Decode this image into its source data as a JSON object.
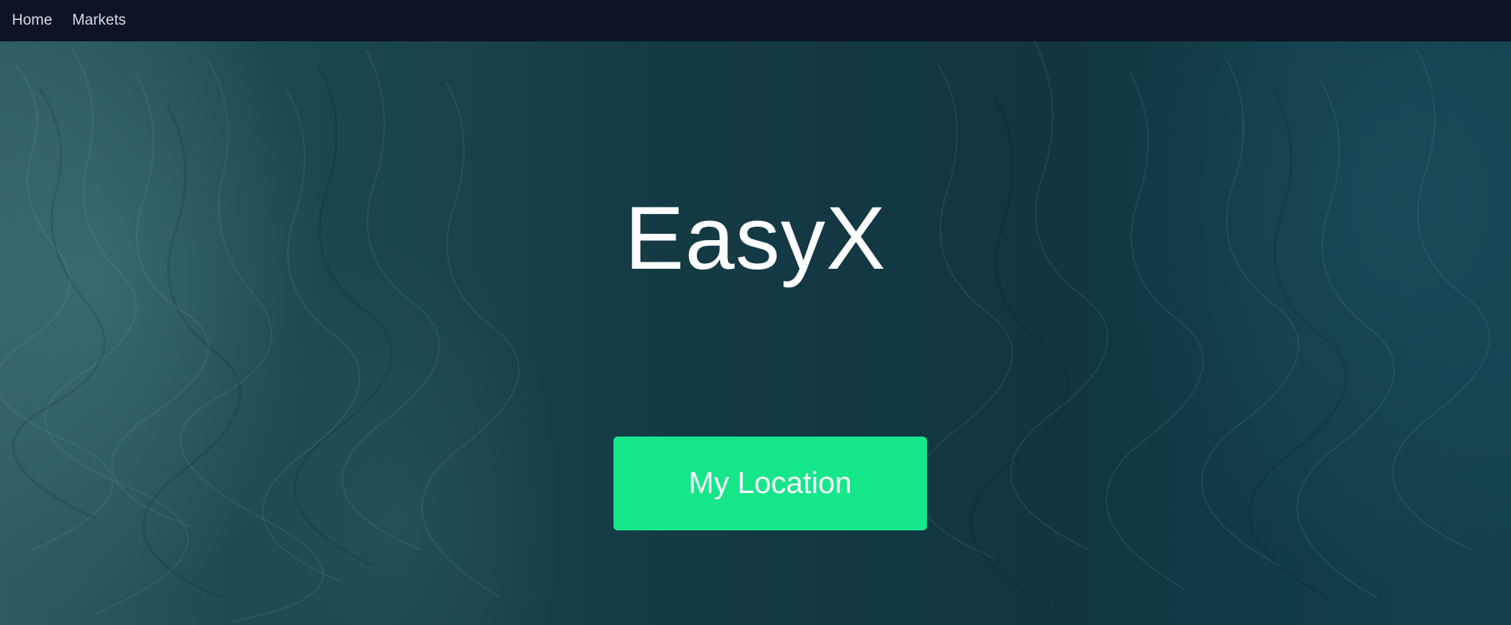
{
  "nav": {
    "items": [
      {
        "label": "Home"
      },
      {
        "label": "Markets"
      }
    ]
  },
  "hero": {
    "title": "EasyX",
    "button_label": "My Location"
  },
  "colors": {
    "navbar_bg": "#0c1424",
    "hero_bg": "#143a44",
    "button_bg": "#16e68a",
    "text": "#ffffff"
  }
}
